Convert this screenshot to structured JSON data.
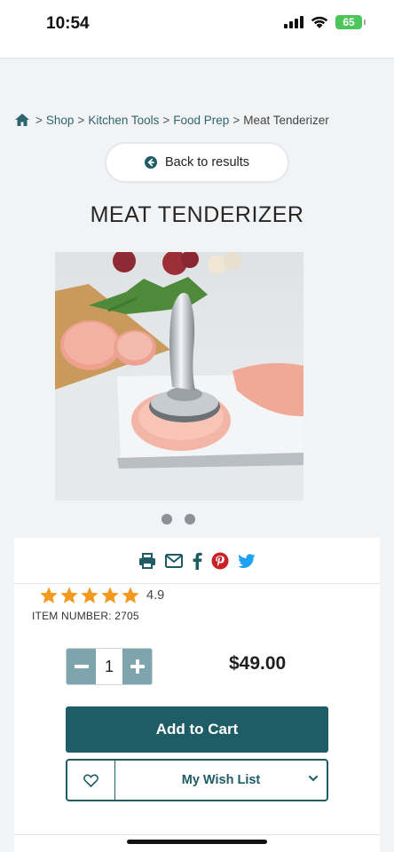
{
  "status_bar": {
    "time": "10:54",
    "battery": "65"
  },
  "breadcrumb": {
    "items": [
      "Shop",
      "Kitchen Tools",
      "Food Prep",
      "Meat Tenderizer"
    ],
    "separator": ">"
  },
  "back_button": {
    "label": "Back to results"
  },
  "product": {
    "title": "MEAT TENDERIZER",
    "image_count": 2,
    "active_image": 1,
    "rating": "4.9",
    "stars": 5,
    "item_number": "ITEM NUMBER: 2705",
    "quantity": "1",
    "price": "$49.00"
  },
  "actions": {
    "add_to_cart": "Add to Cart",
    "wish_list": "My Wish List"
  },
  "share_icons": [
    "print-icon",
    "email-icon",
    "facebook-icon",
    "pinterest-icon",
    "twitter-icon"
  ],
  "colors": {
    "brand_teal": "#1e5c66",
    "qty_button": "#7ea5ae",
    "star": "#f29a1f",
    "pinterest": "#cb2027",
    "twitter": "#1da1f2"
  }
}
